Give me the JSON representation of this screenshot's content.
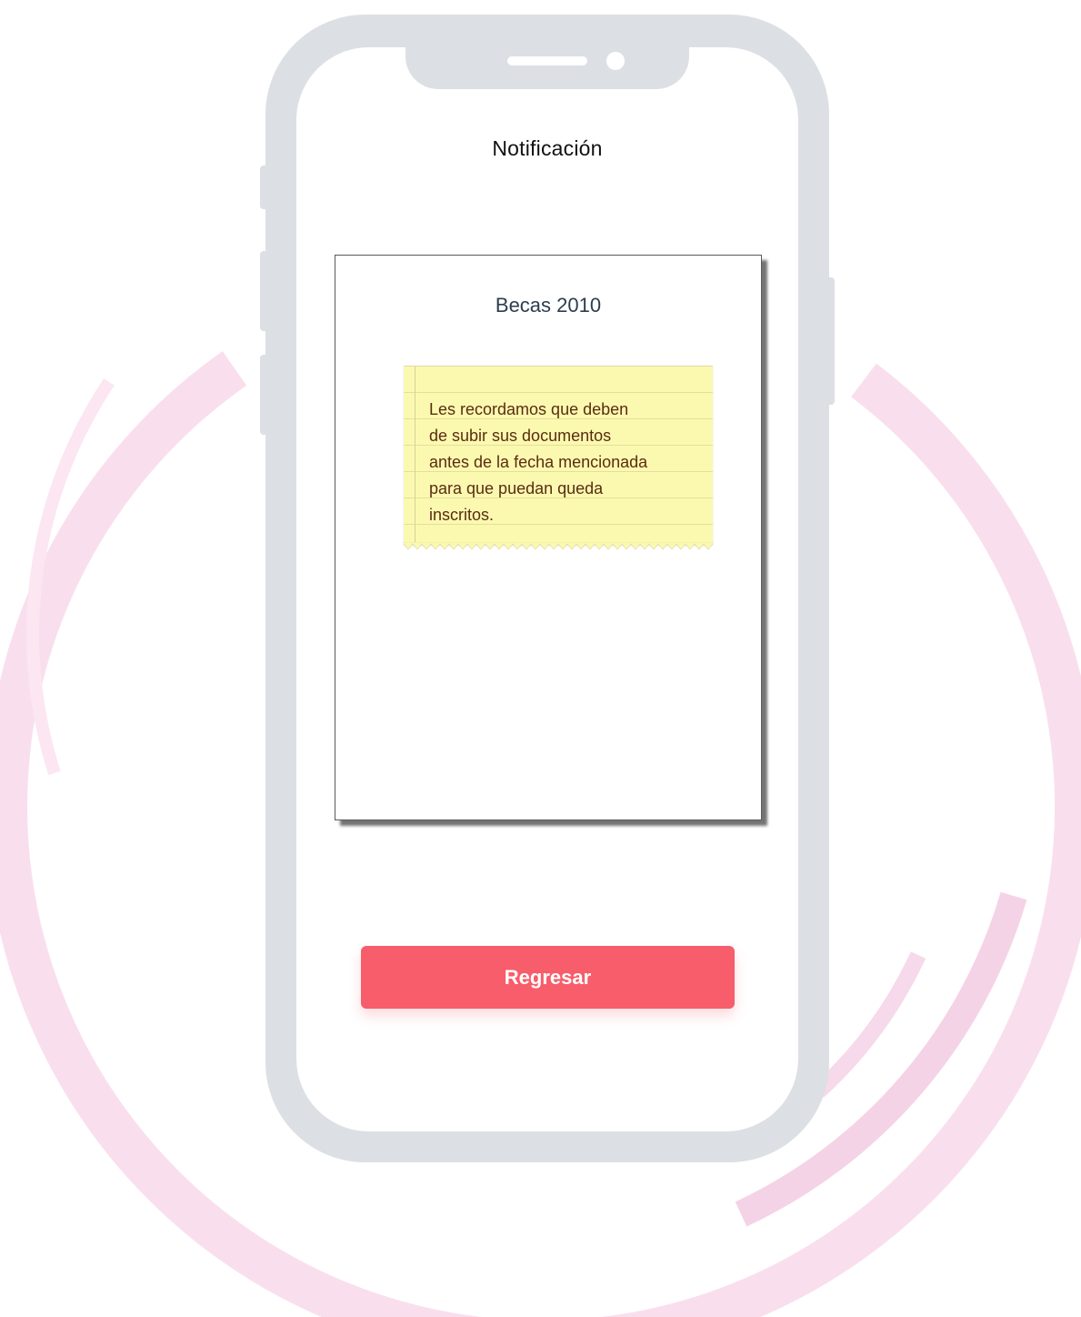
{
  "screen": {
    "title": "Notificación"
  },
  "card": {
    "title": "Becas 2010",
    "note_text": "Les recordamos que deben\nde subir sus documentos\nantes de la fecha mencionada\npara que puedan queda\ninscritos."
  },
  "actions": {
    "back_label": "Regresar"
  },
  "colors": {
    "accent": "#f75d6a",
    "ring": "#f5d3e6",
    "phone_frame": "#dcdfe3",
    "note": "#fbf9b0"
  }
}
